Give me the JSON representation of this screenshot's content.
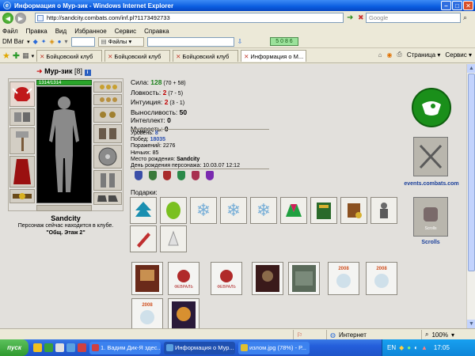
{
  "window": {
    "title": "Информация о Мур-зик - Windows Internet Explorer"
  },
  "address": {
    "url": "http://sandcity.combats.com/inf.pl?1173492733",
    "search_placeholder": "Google"
  },
  "menu": [
    "Файл",
    "Правка",
    "Вид",
    "Избранное",
    "Сервис",
    "Справка"
  ],
  "toolbar": {
    "dm_label": "DM Bar",
    "files_label": "Файлы",
    "green_value": "5 0 8 6"
  },
  "tabs": [
    {
      "label": "Бойцовский клуб",
      "active": false
    },
    {
      "label": "Бойцовский клуб",
      "active": false
    },
    {
      "label": "Бойцовский клуб",
      "active": false
    },
    {
      "label": "Информация о М...",
      "active": true
    }
  ],
  "tab_tools": {
    "page_label": "Страница",
    "service_label": "Сервис"
  },
  "character": {
    "name": "Мур-зик",
    "level": "[8]",
    "info": "i",
    "hp": "1314/1314",
    "caption": "Sandcity",
    "location": "Персонаж сейчас находится в клубе.",
    "room": "\"Общ. Этаж 2\""
  },
  "stats": [
    {
      "label": "Сила: ",
      "value": "128",
      "extra": " (70 + 58)",
      "color": "green"
    },
    {
      "label": "Ловкость: ",
      "value": "2",
      "extra": " (7 - 5)",
      "color": "red"
    },
    {
      "label": "Интуиция: ",
      "value": "2",
      "extra": " (3 - 1)",
      "color": "red"
    },
    {
      "label": "Выносливость: ",
      "value": "50",
      "extra": "",
      "color": "black"
    },
    {
      "label": "Интеллект: ",
      "value": "0",
      "extra": "",
      "color": "black"
    },
    {
      "label": "Мудрость: ",
      "value": "0",
      "extra": "",
      "color": "black"
    }
  ],
  "details": {
    "level_label": "Уровень: ",
    "level_value": "8",
    "wins_label": "Побед: ",
    "wins_value": "18035",
    "losses_label": "Поражений: ",
    "losses_value": "2276",
    "draws_label": "Ничьих: ",
    "draws_value": "85",
    "birthplace_label": "Место рождения: ",
    "birthplace_value": "Sandcity",
    "birthday_label": "День рождения персонажа: ",
    "birthday_value": "10.03.07 12:12"
  },
  "gifts_label": "Подарки:",
  "right_panel": {
    "events_link": "events.combats.com",
    "scrolls_link": "Scrolls",
    "scrolls_banner": "Scrolls"
  },
  "cards": [
    {
      "text": ""
    },
    {
      "text": "ФЕВРАЛЬ"
    },
    {
      "text": "ФЕВРАЛЬ"
    },
    {
      "text": ""
    },
    {
      "text": ""
    },
    {
      "text": "2008"
    },
    {
      "text": "2008"
    },
    {
      "text": "2008"
    },
    {
      "text": ""
    }
  ],
  "statusbar": {
    "zone": "Интернет",
    "zoom": "100%"
  },
  "taskbar": {
    "start": "пуск",
    "tasks": [
      {
        "label": "1. Вадим Дик-Я здес...",
        "active": false
      },
      {
        "label": "Информация о Мур...",
        "active": true
      },
      {
        "label": "излом.jpg (78%) - Р...",
        "active": false
      }
    ],
    "lang": "EN",
    "clock": "17:05"
  }
}
